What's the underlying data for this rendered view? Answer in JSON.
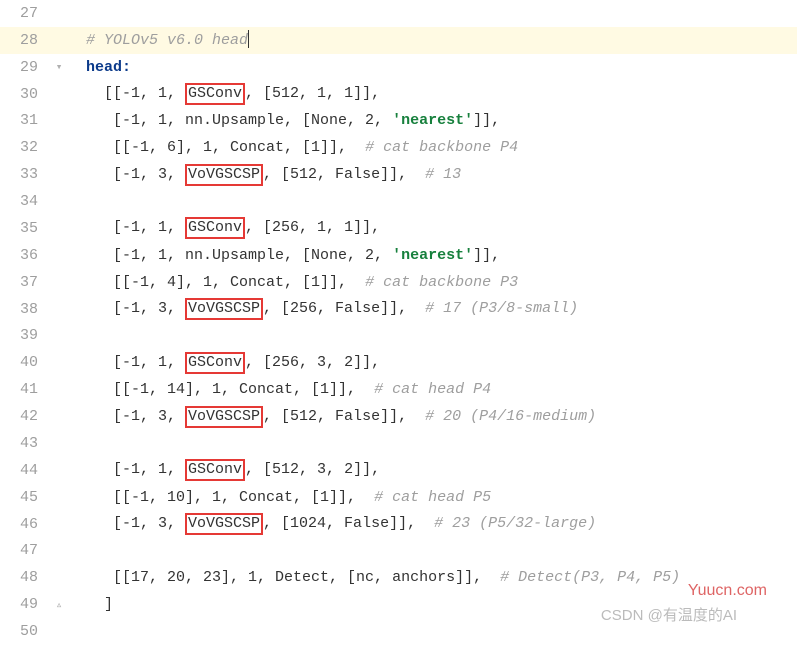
{
  "lines": {
    "27": {
      "num": "27"
    },
    "28": {
      "num": "28",
      "comment": "# YOLOv5 v6.0 head"
    },
    "29": {
      "num": "29",
      "key": "head:"
    },
    "30": {
      "num": "30",
      "pre": "[[-1, 1, ",
      "box": "GSConv",
      "post": ", [512, 1, 1]],"
    },
    "31": {
      "num": "31",
      "pre": " [-1, 1, nn.Upsample, [None, 2, ",
      "str": "'nearest'",
      "post": "]],"
    },
    "32": {
      "num": "32",
      "pre": " [[-1, 6], 1, Concat, [1]],  ",
      "comment": "# cat backbone P4"
    },
    "33": {
      "num": "33",
      "pre": " [-1, 3, ",
      "box": "VoVGSCSP",
      "post": ", [512, False]],  ",
      "comment": "# 13"
    },
    "34": {
      "num": "34"
    },
    "35": {
      "num": "35",
      "pre": " [-1, 1, ",
      "box": "GSConv",
      "post": ", [256, 1, 1]],"
    },
    "36": {
      "num": "36",
      "pre": " [-1, 1, nn.Upsample, [None, 2, ",
      "str": "'nearest'",
      "post": "]],"
    },
    "37": {
      "num": "37",
      "pre": " [[-1, 4], 1, Concat, [1]],  ",
      "comment": "# cat backbone P3"
    },
    "38": {
      "num": "38",
      "pre": " [-1, 3, ",
      "box": "VoVGSCSP",
      "post": ", [256, False]],  ",
      "comment": "# 17 (P3/8-small)"
    },
    "39": {
      "num": "39"
    },
    "40": {
      "num": "40",
      "pre": " [-1, 1, ",
      "box": "GSConv",
      "post": ", [256, 3, 2]],"
    },
    "41": {
      "num": "41",
      "pre": " [[-1, 14], 1, Concat, [1]],  ",
      "comment": "# cat head P4"
    },
    "42": {
      "num": "42",
      "pre": " [-1, 3, ",
      "box": "VoVGSCSP",
      "post": ", [512, False]],  ",
      "comment": "# 20 (P4/16-medium)"
    },
    "43": {
      "num": "43"
    },
    "44": {
      "num": "44",
      "pre": " [-1, 1, ",
      "box": "GSConv",
      "post": ", [512, 3, 2]],"
    },
    "45": {
      "num": "45",
      "pre": " [[-1, 10], 1, Concat, [1]],  ",
      "comment": "# cat head P5"
    },
    "46": {
      "num": "46",
      "pre": " [-1, 3, ",
      "box": "VoVGSCSP",
      "post": ", [1024, False]],  ",
      "comment": "# 23 (P5/32-large)"
    },
    "47": {
      "num": "47"
    },
    "48": {
      "num": "48",
      "pre": " [[17, 20, 23], 1, Detect, [nc, anchors]],  ",
      "comment": "# Detect(P3, P4, P5)"
    },
    "49": {
      "num": "49",
      "pre": "]"
    },
    "50": {
      "num": "50"
    }
  },
  "indent_top": "  ",
  "indent_body": "    ",
  "watermark1": "Yuucn.com",
  "watermark2": "CSDN @有温度的AI"
}
